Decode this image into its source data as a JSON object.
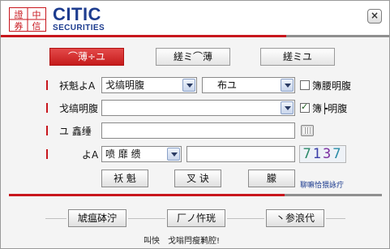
{
  "logo": {
    "title": "CITIC",
    "subtitle": "SECURITIES",
    "mark_chars": [
      "中",
      "信",
      "證",
      "券"
    ]
  },
  "window": {
    "close_label": "×"
  },
  "tabs": [
    {
      "label": "⌒薄÷ユ",
      "active": true
    },
    {
      "label": "縒ミ⌒薄",
      "active": false
    },
    {
      "label": "縒ミユ",
      "active": false
    }
  ],
  "form": {
    "account_type": {
      "label": "袄魁よA",
      "value": "戈缟明腹",
      "sub_value": "布ユ",
      "check_label": "簿腰明腹",
      "checked": false
    },
    "account": {
      "label": "戈缟明腹",
      "value": "",
      "check_label": "簿┝明腹",
      "checked": true
    },
    "password": {
      "label": "ユ 鑫缍",
      "value": ""
    },
    "verify": {
      "label": "よA",
      "value": "喷 靡 缋",
      "input_value": "",
      "captcha": "7137"
    }
  },
  "buttons": {
    "login": "袄 魁",
    "reset": "叉 诀",
    "other": "朦",
    "link": "聊嘛恰猥詠疔"
  },
  "footer": {
    "btn1": "虓瘟砵泞",
    "btn2": "厂ノ忤珖",
    "btn3": "丶参浪代",
    "hotline_label": "叫怏",
    "hotline_text": "戈嗡閂瘦鹣腔!"
  },
  "colors": {
    "brand_red": "#c8161d",
    "brand_blue": "#1d3c8f",
    "captcha": [
      "#2c8a6a",
      "#3a3fa8",
      "#7b2fa0",
      "#2a8ca6"
    ]
  }
}
